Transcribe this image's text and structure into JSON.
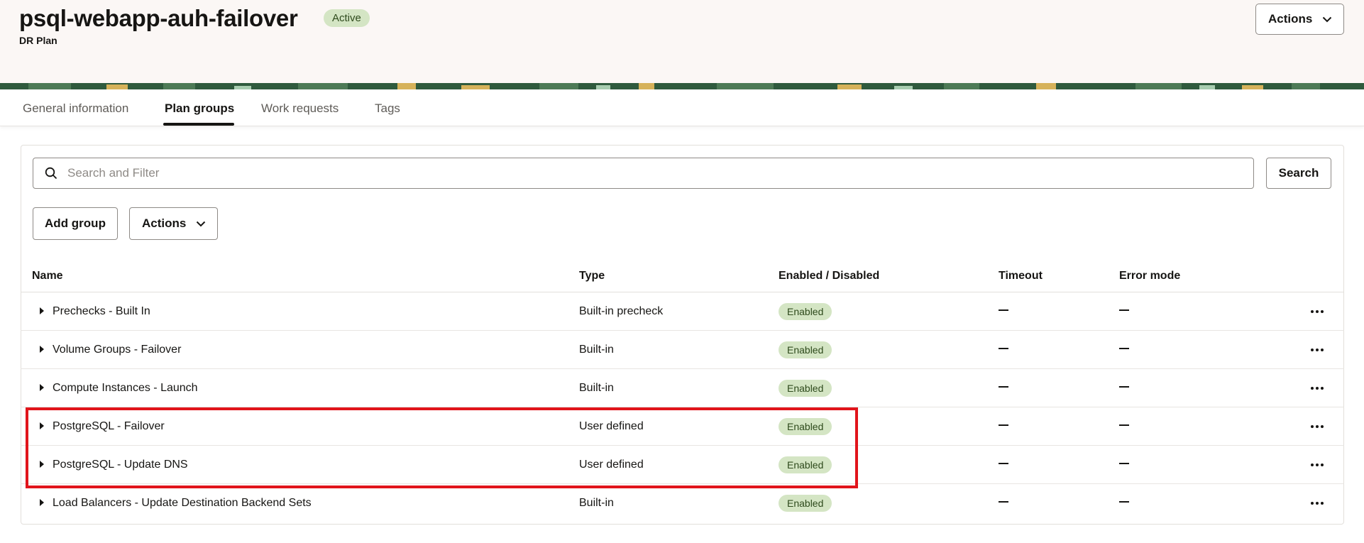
{
  "header": {
    "title": "psql-webapp-auh-failover",
    "status": "Active",
    "subtitle": "DR Plan",
    "actions_label": "Actions"
  },
  "tabs": [
    {
      "label": "General information",
      "active": false
    },
    {
      "label": "Plan groups",
      "active": true
    },
    {
      "label": "Work requests",
      "active": false
    },
    {
      "label": "Tags",
      "active": false
    }
  ],
  "toolbar": {
    "search_placeholder": "Search and Filter",
    "search_label": "Search",
    "add_group_label": "Add group",
    "actions_label": "Actions"
  },
  "table": {
    "columns": [
      "Name",
      "Type",
      "Enabled / Disabled",
      "Timeout",
      "Error mode"
    ],
    "rows": [
      {
        "name": "Prechecks - Built In",
        "type": "Built-in precheck",
        "enabled": "Enabled",
        "timeout": "—",
        "error_mode": "—"
      },
      {
        "name": "Volume Groups - Failover",
        "type": "Built-in",
        "enabled": "Enabled",
        "timeout": "—",
        "error_mode": "—"
      },
      {
        "name": "Compute Instances - Launch",
        "type": "Built-in",
        "enabled": "Enabled",
        "timeout": "—",
        "error_mode": "—"
      },
      {
        "name": "PostgreSQL - Failover",
        "type": "User defined",
        "enabled": "Enabled",
        "timeout": "—",
        "error_mode": "—"
      },
      {
        "name": "PostgreSQL - Update DNS",
        "type": "User defined",
        "enabled": "Enabled",
        "timeout": "—",
        "error_mode": "—"
      },
      {
        "name": "Load Balancers - Update Destination Backend Sets",
        "type": "Built-in",
        "enabled": "Enabled",
        "timeout": "—",
        "error_mode": "—"
      }
    ]
  },
  "icons": {
    "search": "search-icon",
    "chevron": "chevron-down-icon",
    "expand": "caret-right-icon",
    "row_menu": "more-horizontal-icon"
  },
  "colors": {
    "badge_bg": "#d4e5c4",
    "badge_text": "#2e4a1c",
    "highlight": "#e1141b",
    "banner": "#2f5a3d"
  }
}
